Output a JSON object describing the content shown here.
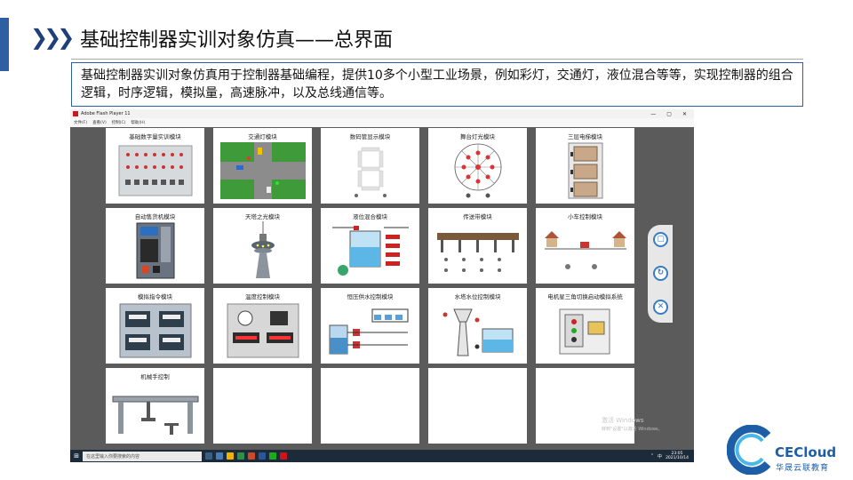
{
  "slide": {
    "title": "基础控制器实训对象仿真——总界面",
    "description": "基础控制器实训对象仿真用于控制器基础编程，提供10多个小型工业场景，例如彩灯，交通灯，液位混合等等，实现控制器的组合逻辑，时序逻辑，模拟量，高速脉冲，以及总线通信等。"
  },
  "window": {
    "title": "Adobe Flash Player 11",
    "menu": [
      "文件(F)",
      "查看(V)",
      "控制(C)",
      "帮助(H)"
    ],
    "controls": [
      "—",
      "▢",
      "✕"
    ]
  },
  "modules": [
    {
      "title": "基础数字量实训模块",
      "icon": "digital-io-panel-icon"
    },
    {
      "title": "交通灯模块",
      "icon": "traffic-intersection-icon"
    },
    {
      "title": "数码管显示模块",
      "icon": "seven-segment-icon"
    },
    {
      "title": "舞台灯光模块",
      "icon": "stage-lights-icon"
    },
    {
      "title": "三层电梯模块",
      "icon": "elevator-icon"
    },
    {
      "title": "自动售货机模块",
      "icon": "vending-machine-icon"
    },
    {
      "title": "天塔之光模块",
      "icon": "tower-lights-icon"
    },
    {
      "title": "液位混合模块",
      "icon": "liquid-mixing-icon"
    },
    {
      "title": "传送带模块",
      "icon": "conveyor-icon"
    },
    {
      "title": "小车控制模块",
      "icon": "cart-control-icon"
    },
    {
      "title": "模拟指令模块",
      "icon": "analog-command-icon"
    },
    {
      "title": "温度控制模块",
      "icon": "temperature-control-icon"
    },
    {
      "title": "恒压供水控制模块",
      "icon": "water-supply-icon"
    },
    {
      "title": "水塔水位控制模块",
      "icon": "water-tower-icon"
    },
    {
      "title": "电机星三角切换启动模拟系统",
      "icon": "motor-star-delta-icon"
    },
    {
      "title": "机械手控制",
      "icon": "manipulator-icon"
    },
    {
      "title": "",
      "icon": ""
    },
    {
      "title": "",
      "icon": ""
    },
    {
      "title": "",
      "icon": ""
    },
    {
      "title": "",
      "icon": ""
    }
  ],
  "side_panel": [
    {
      "icon": "screen-icon",
      "glyph": "▢"
    },
    {
      "icon": "refresh-icon",
      "glyph": "↻"
    },
    {
      "icon": "close-icon",
      "glyph": "✕"
    }
  ],
  "watermark": {
    "line1": "激活 Windows",
    "line2": "转到\"设置\"以激活 Windows。"
  },
  "taskbar": {
    "search_placeholder": "在这里输入你要搜索的内容",
    "ime": "中",
    "time": "23:05",
    "date": "2021/10/14"
  },
  "brand": {
    "name": "CECloud",
    "sub": "华晟云联教育"
  },
  "colors": {
    "accent": "#2e5fa3",
    "brand": "#1d5ea6",
    "window_bg": "#5b5b5b"
  }
}
